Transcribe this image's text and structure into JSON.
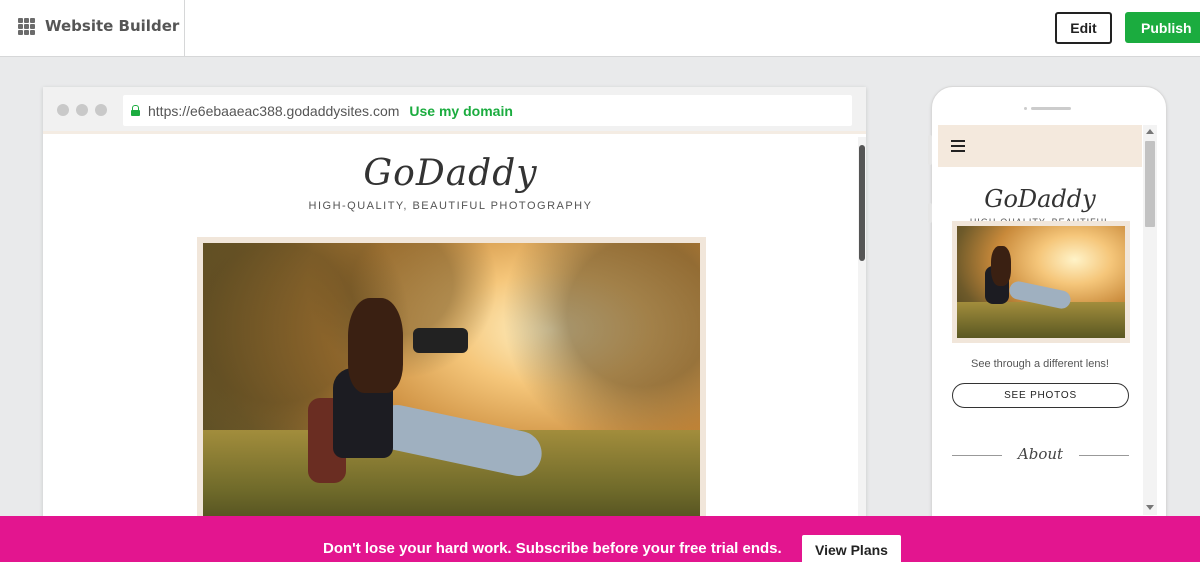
{
  "topbar": {
    "app_title": "Website Builder",
    "edit_label": "Edit",
    "publish_label": "Publish"
  },
  "desktop_preview": {
    "url": "https://e6ebaaeac388.godaddysites.com",
    "domain_link": "Use my domain",
    "site": {
      "logo": "GoDaddy",
      "tagline": "HIGH-QUALITY, BEAUTIFUL PHOTOGRAPHY"
    }
  },
  "mobile_preview": {
    "logo": "GoDaddy",
    "tagline": "HIGH-QUALITY, BEAUTIFUL PHOTOGRAPHY",
    "caption": "See through a different lens!",
    "button_label": "SEE PHOTOS",
    "section_title": "About"
  },
  "banner": {
    "message": "Don't lose your hard work. Subscribe before your free trial ends.",
    "button_label": "View Plans"
  },
  "colors": {
    "publish_green": "#1bac3f",
    "banner_pink": "#e3158f",
    "header_beige": "#f4e9dd"
  },
  "icons": [
    "apps-grid-icon",
    "lock-icon",
    "hamburger-icon"
  ]
}
